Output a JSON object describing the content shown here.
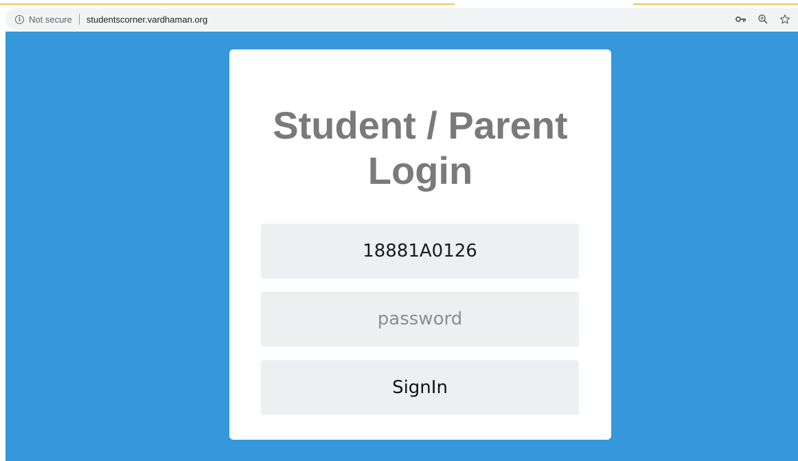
{
  "browser": {
    "security_label": "Not secure",
    "url": "studentscorner.vardhaman.org",
    "icons": [
      "info-icon",
      "key-icon",
      "zoom-icon",
      "star-icon"
    ]
  },
  "login": {
    "title_line1": "Student / Parent",
    "title_line2": "Login",
    "username_value": "18881A0126",
    "password_placeholder": "password",
    "signin_label": "SignIn"
  },
  "colors": {
    "page_background": "#3498db",
    "card_background": "#ffffff",
    "field_background": "#ecf0f1",
    "title_color": "#7a7a7a",
    "tab_accent": "#e7c45e"
  }
}
